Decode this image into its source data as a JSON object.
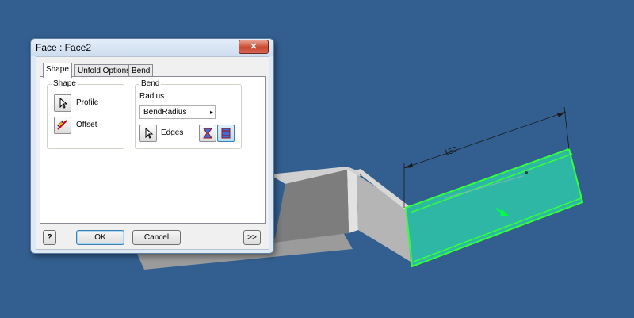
{
  "dialog": {
    "title": "Face : Face2",
    "close_label": "✕",
    "tabs": [
      {
        "label": "Shape",
        "active": true
      },
      {
        "label": "Unfold Options",
        "active": false
      },
      {
        "label": "Bend",
        "active": false
      }
    ],
    "shape_group": {
      "label": "Shape",
      "profile_label": "Profile",
      "offset_label": "Offset"
    },
    "bend_group": {
      "label": "Bend",
      "radius_label": "Radius",
      "radius_value": "BendRadius",
      "edges_label": "Edges"
    },
    "buttons": {
      "help": "?",
      "ok": "OK",
      "cancel": "Cancel",
      "more": ">>"
    }
  },
  "viewport": {
    "dimension_value": "150",
    "background_color": "#335f90",
    "part_color": "#a9a9a9",
    "selected_face_color": "#2fb7a6",
    "highlight_edge_color": "#34ff3a"
  }
}
